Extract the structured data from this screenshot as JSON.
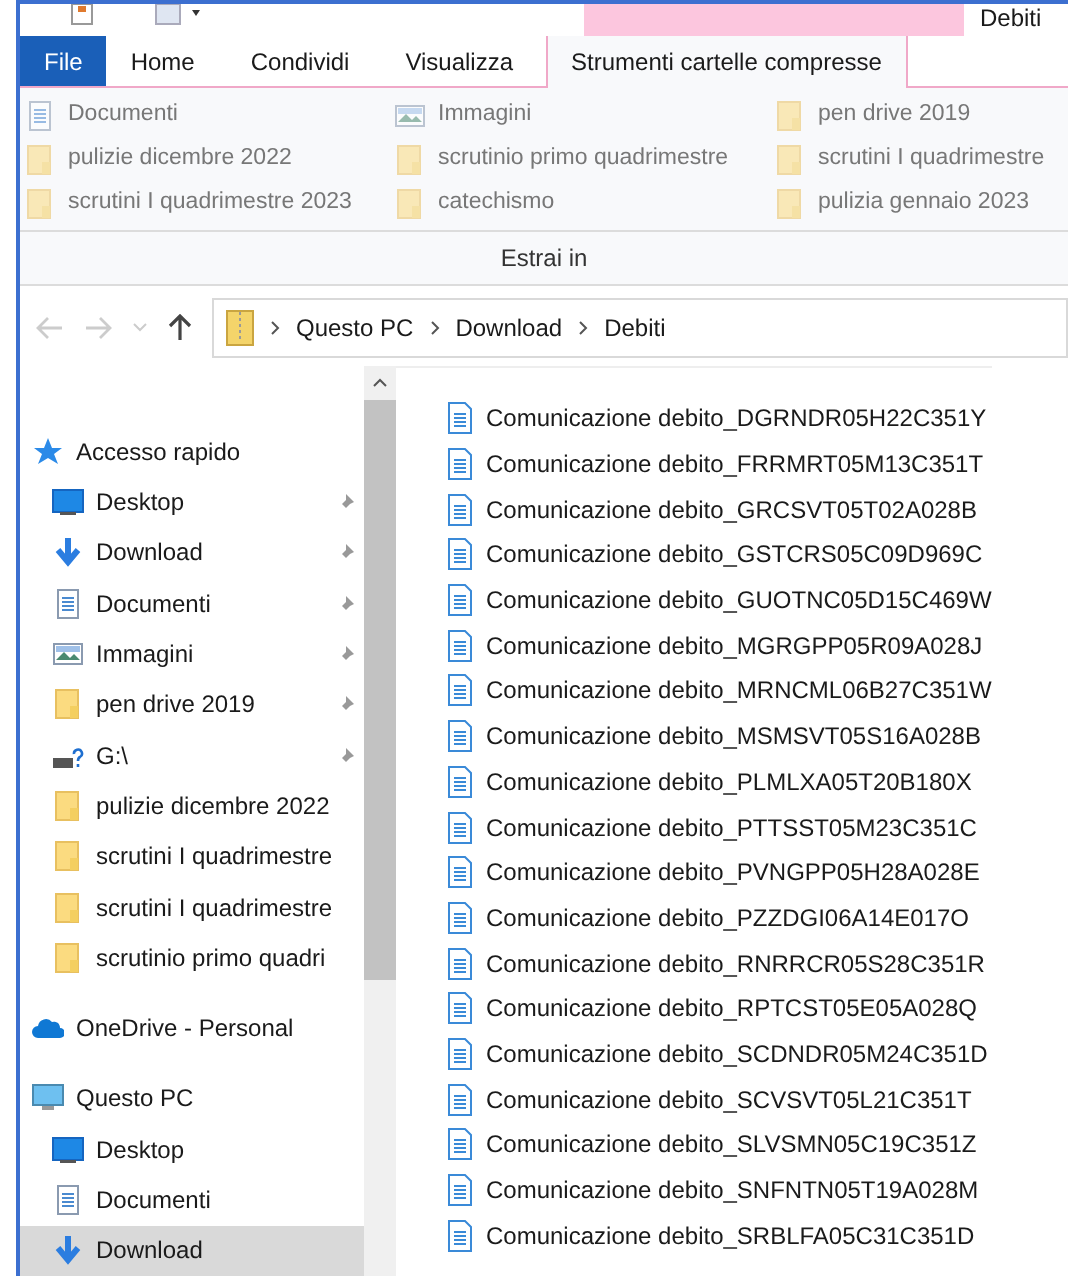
{
  "window": {
    "title": "Debiti"
  },
  "tabs": [
    {
      "label": "File",
      "kind": "file",
      "selected": false
    },
    {
      "label": "Home",
      "kind": "tab",
      "selected": false
    },
    {
      "label": "Condividi",
      "kind": "tab",
      "selected": false
    },
    {
      "label": "Visualizza",
      "kind": "tab",
      "selected": false
    },
    {
      "label": "Strumenti cartelle compresse",
      "kind": "context",
      "selected": true
    }
  ],
  "ribbon": {
    "destinations": [
      {
        "label": "Documenti",
        "kind": "documents"
      },
      {
        "label": "Immagini",
        "kind": "pictures"
      },
      {
        "label": "pen drive 2019",
        "kind": "folder"
      },
      {
        "label": "pulizie dicembre 2022",
        "kind": "folder"
      },
      {
        "label": "scrutinio primo quadrimestre",
        "kind": "folder"
      },
      {
        "label": "scrutini I quadrimestre",
        "kind": "folder"
      },
      {
        "label": "scrutini I quadrimestre 2023",
        "kind": "folder"
      },
      {
        "label": "catechismo",
        "kind": "folder"
      },
      {
        "label": "pulizia gennaio 2023",
        "kind": "folder"
      }
    ],
    "group_label": "Estrai in"
  },
  "address_bar": {
    "path": [
      "Questo PC",
      "Download",
      "Debiti"
    ]
  },
  "sidebar": {
    "items": [
      {
        "label": "Accesso rapido",
        "kind": "star",
        "selected": false,
        "children": [
          {
            "label": "Desktop",
            "kind": "desktop",
            "pinned": true,
            "selected": false
          },
          {
            "label": "Download",
            "kind": "download",
            "pinned": true,
            "selected": false
          },
          {
            "label": "Documenti",
            "kind": "documents",
            "pinned": true,
            "selected": false
          },
          {
            "label": "Immagini",
            "kind": "pictures",
            "pinned": true,
            "selected": false
          },
          {
            "label": "pen drive 2019",
            "kind": "folder",
            "pinned": true,
            "selected": false
          },
          {
            "label": "G:\\",
            "kind": "drive",
            "pinned": true,
            "selected": false
          },
          {
            "label": "pulizie dicembre 2022",
            "kind": "folder",
            "pinned": false,
            "selected": false
          },
          {
            "label": "scrutini I quadrimestre",
            "kind": "folder",
            "pinned": false,
            "selected": false
          },
          {
            "label": "scrutini I quadrimestre",
            "kind": "folder",
            "pinned": false,
            "selected": false
          },
          {
            "label": "scrutinio primo quadri",
            "kind": "folder",
            "pinned": false,
            "selected": false
          }
        ]
      },
      {
        "label": "OneDrive - Personal",
        "kind": "cloud",
        "selected": false
      },
      {
        "label": "Questo PC",
        "kind": "pc",
        "selected": false,
        "children": [
          {
            "label": "Desktop",
            "kind": "desktop",
            "pinned": false,
            "selected": false
          },
          {
            "label": "Documenti",
            "kind": "documents",
            "pinned": false,
            "selected": false
          },
          {
            "label": "Download",
            "kind": "download",
            "pinned": false,
            "selected": true
          }
        ]
      }
    ]
  },
  "files": [
    "Comunicazione debito_DGRNDR05H22C351Y",
    "Comunicazione debito_FRRMRT05M13C351T",
    "Comunicazione debito_GRCSVT05T02A028B",
    "Comunicazione debito_GSTCRS05C09D969C",
    "Comunicazione debito_GUOTNC05D15C469W",
    "Comunicazione debito_MGRGPP05R09A028J",
    "Comunicazione debito_MRNCML06B27C351W",
    "Comunicazione debito_MSMSVT05S16A028B",
    "Comunicazione debito_PLMLXA05T20B180X",
    "Comunicazione debito_PTTSST05M23C351C",
    "Comunicazione debito_PVNGPP05H28A028E",
    "Comunicazione debito_PZZDGI06A14E017O",
    "Comunicazione debito_RNRRCR05S28C351R",
    "Comunicazione debito_RPTCST05E05A028Q",
    "Comunicazione debito_SCDNDR05M24C351D",
    "Comunicazione debito_SCVSVT05L21C351T",
    "Comunicazione debito_SLVSMN05C19C351Z",
    "Comunicazione debito_SNFNTN05T19A028M",
    "Comunicazione debito_SRBLFA05C31C351D"
  ]
}
